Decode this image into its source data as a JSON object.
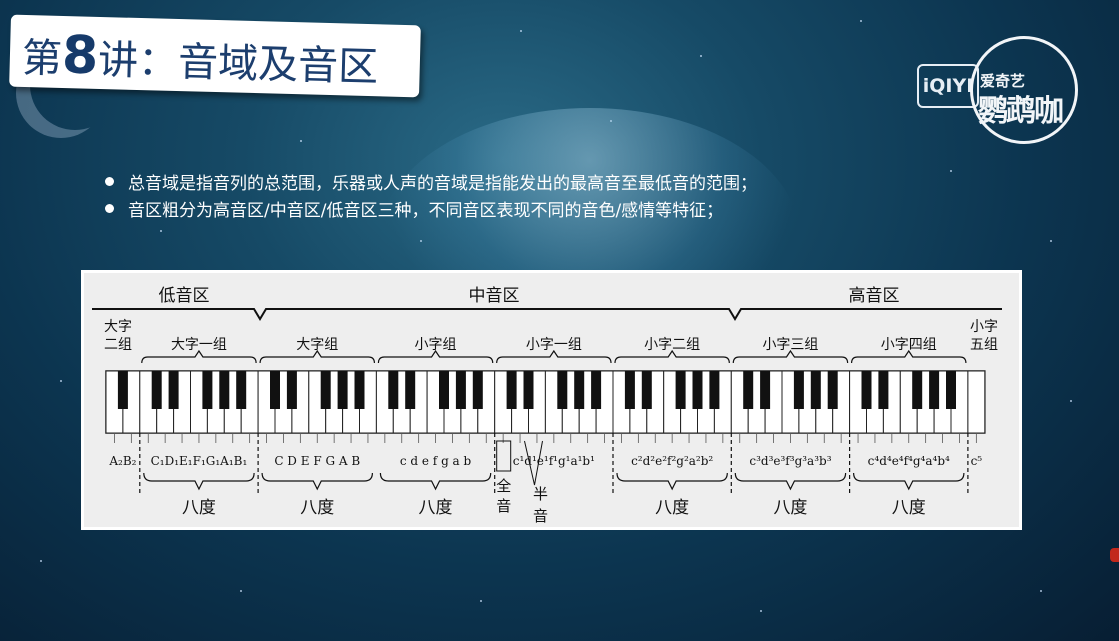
{
  "slide": {
    "title_prefix": "第",
    "title_number": "8",
    "title_suffix": "讲：音域及音区"
  },
  "bullets": [
    "总音域是指音列的总范围，乐器或人声的音域是指能发出的最高音至最低音的范围；",
    "音区粗分为高音区/中音区/低音区三种，不同音区表现不同的音色/感情等特征；"
  ],
  "logo": {
    "iqiyi_text": "iQIYI",
    "channel_small": "爱奇艺",
    "channel_big": "鹦鹉咖"
  },
  "diagram": {
    "registers": [
      "低音区",
      "中音区",
      "高音区"
    ],
    "groups": [
      {
        "line1": "大字",
        "line2": "二组"
      },
      {
        "line1": "大字一组",
        "line2": ""
      },
      {
        "line1": "大字组",
        "line2": ""
      },
      {
        "line1": "小字组",
        "line2": ""
      },
      {
        "line1": "小字一组",
        "line2": ""
      },
      {
        "line1": "小字二组",
        "line2": ""
      },
      {
        "line1": "小字三组",
        "line2": ""
      },
      {
        "line1": "小字四组",
        "line2": ""
      },
      {
        "line1": "小字",
        "line2": "五组"
      }
    ],
    "octave_label": "八度",
    "whole_tone_label": "全音",
    "semitone_label": "半音",
    "note_names": [
      "A₂B₂",
      "C₁D₁E₁F₁G₁A₁B₁",
      "C D E F G A B",
      "c d e f g a b",
      "c¹d¹e¹f¹g¹a¹b¹",
      "c²d²e²f²g²a²b²",
      "c³d³e³f³g³a³b³",
      "c⁴d⁴e⁴f⁴g⁴a⁴b⁴",
      "c⁵"
    ]
  }
}
